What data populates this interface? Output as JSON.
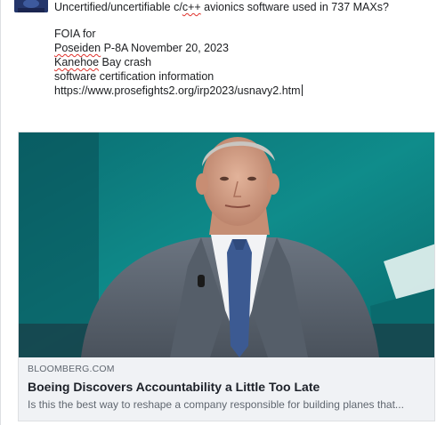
{
  "post": {
    "line1": "Uncertified/uncertifiable c/c++ avionics software used in 737 MAXs?",
    "line1_prefix": "Uncertified/uncertifiable c/",
    "line1_misspelled": "c++",
    "line1_suffix": " avionics software used in 737 MAXs?",
    "line3": "FOIA for",
    "line4_word": "Poseiden",
    "line4_rest": " P-8A November 20, 2023",
    "line5_word": "Kanehoe",
    "line5_rest": " Bay crash",
    "line6": "software certification information",
    "line7": "https://www.prosefights2.org/irp2023/usnavy2.htm"
  },
  "link_card": {
    "domain": "BLOOMBERG.COM",
    "title": "Boeing Discovers Accountability a Little Too Late",
    "description": "Is this the best way to reshape a company responsible for building planes that..."
  },
  "image": {
    "subject": "man-in-gray-suit-with-lapel-microphone",
    "colors": {
      "backdrop_teal": "#0e8a8a",
      "suit_gray": "#5b6470",
      "tie_blue": "#3c5a92",
      "shirt_white": "#f2f3f5"
    }
  },
  "colors": {
    "text_primary": "#1c1e21",
    "text_secondary": "#606770",
    "spellcheck_red": "#e0312b",
    "card_bg": "#f0f2f5",
    "border": "#dddfe2"
  }
}
